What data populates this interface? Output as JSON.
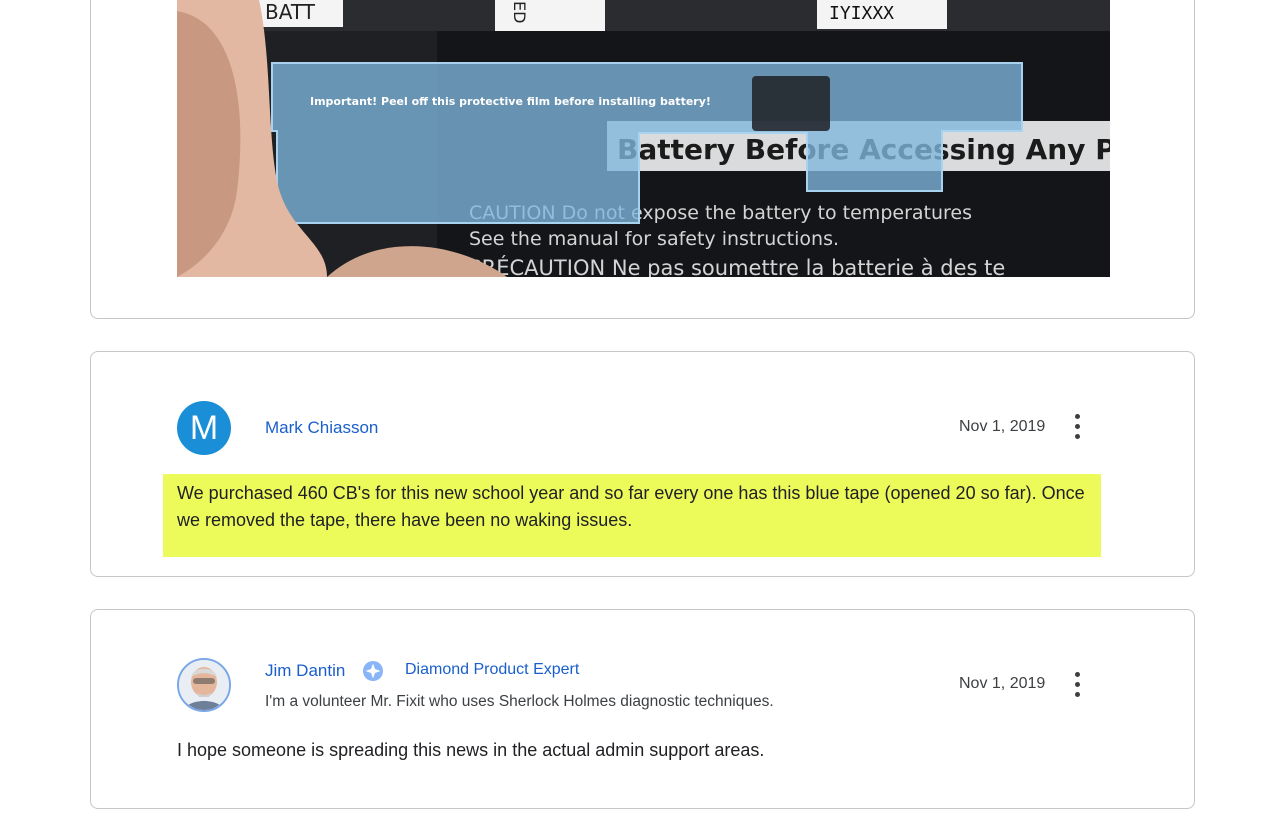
{
  "photo": {
    "alt": "Chromebook battery with blue protective film",
    "film_text": "Important! Peel off this protective film before installing battery!",
    "label_batt": "BATT",
    "label_fragment": "ED",
    "barcode_fragment": "IYIXXX",
    "battery_line1": "Battery Before Accessing Any Pa",
    "battery_line2": "CAUTION Do not expose the battery to temperatures",
    "battery_line3": "See the manual for safety instructions.",
    "battery_line4": "PRÉCAUTION Ne pas soumettre la batterie à des te"
  },
  "replies": [
    {
      "avatar_letter": "M",
      "author": "Mark Chiasson",
      "date": "Nov 1, 2019",
      "body": "We purchased 460 CB's for this new school year and so far every one has this blue tape (opened 20 so far). Once we removed the tape, there have been no waking issues.",
      "highlight_color": "#ecfa5a",
      "avatar_color": "#1a8fd8"
    },
    {
      "author": "Jim Dantin",
      "badge_icon": "diamond-star-icon",
      "expert_level": "Diamond Product Expert",
      "tagline": "I'm a volunteer Mr. Fixit who uses Sherlock Holmes diagnostic techniques.",
      "date": "Nov 1, 2019",
      "body": "I hope someone is spreading this news in the actual admin support areas."
    }
  ],
  "colors": {
    "link": "#1a5fcc",
    "border": "#c4c7c5",
    "text": "#3c4043"
  }
}
